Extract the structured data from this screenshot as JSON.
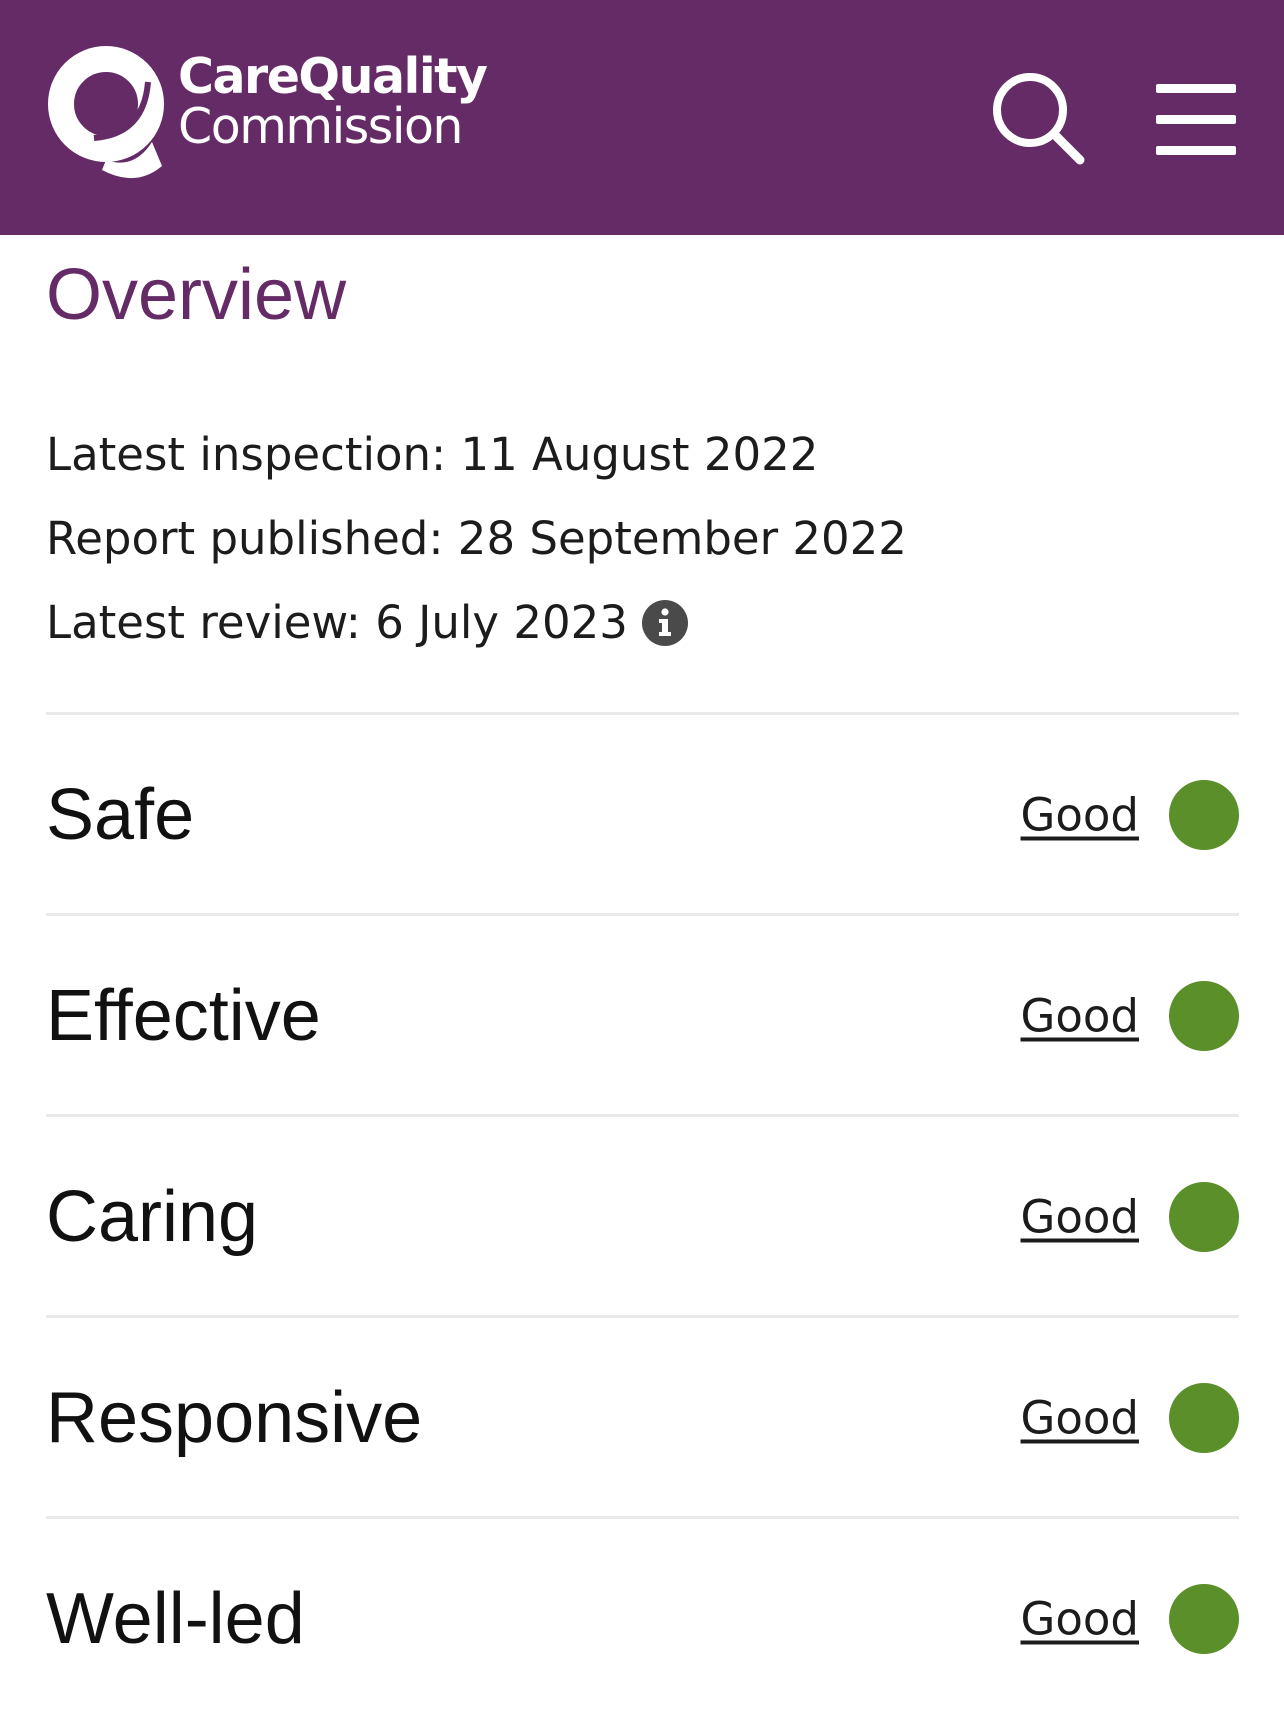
{
  "header": {
    "background_color": "#642b66",
    "logo": {
      "line1": "CareQuality",
      "line2": "Commission",
      "icon": "cqc-q-logo"
    },
    "search_icon": "search-icon",
    "menu_icon": "hamburger-menu-icon"
  },
  "overview": {
    "title": "Overview",
    "title_color": "#642b66",
    "latest_inspection": "Latest inspection: 11 August 2022",
    "report_published": "Report published: 28 September 2022",
    "latest_review": "Latest review: 6 July 2023",
    "info_icon": "info-icon"
  },
  "ratings": [
    {
      "label": "Safe",
      "rating": "Good",
      "color": "#5a8f29"
    },
    {
      "label": "Effective",
      "rating": "Good",
      "color": "#5a8f29"
    },
    {
      "label": "Caring",
      "rating": "Good",
      "color": "#5a8f29"
    },
    {
      "label": "Responsive",
      "rating": "Good",
      "color": "#5a8f29"
    },
    {
      "label": "Well-led",
      "rating": "Good",
      "color": "#5a8f29"
    }
  ]
}
